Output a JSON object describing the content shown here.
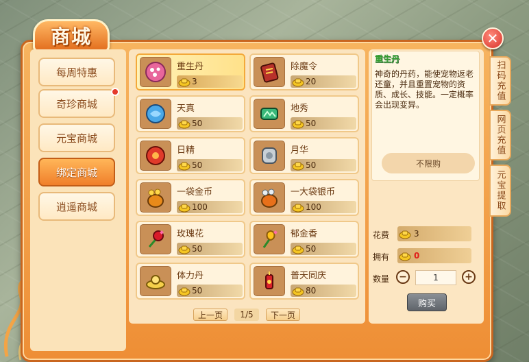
{
  "title": "商城",
  "nav": [
    {
      "label": "每周特惠",
      "active": false,
      "badge": false
    },
    {
      "label": "奇珍商城",
      "active": false,
      "badge": true
    },
    {
      "label": "元宝商城",
      "active": false,
      "badge": false
    },
    {
      "label": "绑定商城",
      "active": true,
      "badge": false
    },
    {
      "label": "逍遥商城",
      "active": false,
      "badge": false
    }
  ],
  "items": [
    {
      "name": "重生丹",
      "price": "3",
      "icon": "rebirth-pill-icon",
      "selected": true
    },
    {
      "name": "除魔令",
      "price": "20",
      "icon": "demon-token-icon"
    },
    {
      "name": "天真",
      "price": "50",
      "icon": "blue-orb-icon"
    },
    {
      "name": "地秀",
      "price": "50",
      "icon": "green-gem-icon"
    },
    {
      "name": "日精",
      "price": "50",
      "icon": "sun-orb-icon"
    },
    {
      "name": "月华",
      "price": "50",
      "icon": "moon-stone-icon"
    },
    {
      "name": "一袋金币",
      "price": "100",
      "icon": "gold-bag-icon"
    },
    {
      "name": "一大袋银币",
      "price": "100",
      "icon": "silver-bag-icon"
    },
    {
      "name": "玫瑰花",
      "price": "50",
      "icon": "rose-icon"
    },
    {
      "name": "郁金香",
      "price": "50",
      "icon": "tulip-icon"
    },
    {
      "name": "体力丹",
      "price": "50",
      "icon": "stamina-pill-icon"
    },
    {
      "name": "普天同庆",
      "price": "80",
      "icon": "firecracker-icon"
    }
  ],
  "pager": {
    "prev": "上一页",
    "page": "1/5",
    "next": "下一页"
  },
  "detail": {
    "title": "重生丹",
    "description": "神奇的丹药，能使宠物返老还童，并且重置宠物的资质、成长、技能。一定概率会出现变异。",
    "limit": "不限购",
    "cost_label": "花费",
    "cost_value": "3",
    "own_label": "拥有",
    "own_value": "0",
    "qty_label": "数量",
    "qty_value": "1",
    "buy": "购买"
  },
  "side_tabs": [
    "扫码充值",
    "网页充值",
    "元宝提取"
  ],
  "colors": {
    "accent": "#f07f2a",
    "price_red": "#e0201a",
    "desc_title": "#2f9a2a"
  }
}
